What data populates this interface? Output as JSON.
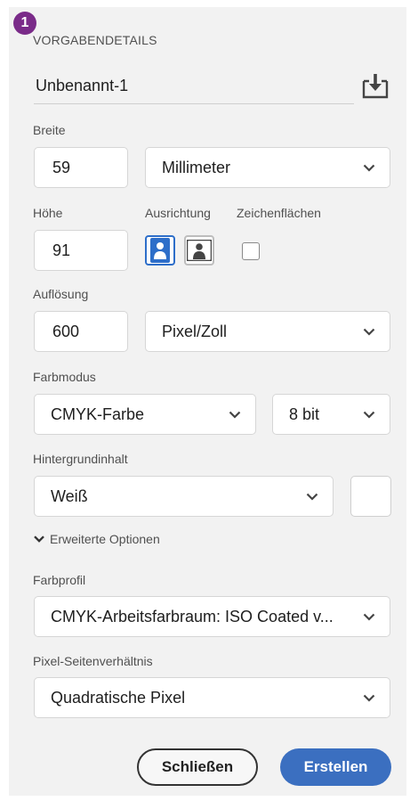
{
  "badge": "1",
  "preset": {
    "heading": "VORGABENDETAILS",
    "name": "Unbenannt-1"
  },
  "width": {
    "label": "Breite",
    "value": "59",
    "unit": "Millimeter"
  },
  "height": {
    "label": "Höhe",
    "value": "91"
  },
  "orientation": {
    "label": "Ausrichtung",
    "selected": "portrait"
  },
  "artboards": {
    "label": "Zeichenflächen",
    "checked": false
  },
  "resolution": {
    "label": "Auflösung",
    "value": "600",
    "unit": "Pixel/Zoll"
  },
  "color_mode": {
    "label": "Farbmodus",
    "mode": "CMYK-Farbe",
    "depth": "8 bit"
  },
  "background": {
    "label": "Hintergrundinhalt",
    "value": "Weiß",
    "swatch_color": "#ffffff"
  },
  "advanced": {
    "label": "Erweiterte Optionen"
  },
  "color_profile": {
    "label": "Farbprofil",
    "value": "CMYK-Arbeitsfarbraum: ISO Coated v..."
  },
  "pixel_aspect": {
    "label": "Pixel-Seitenverhältnis",
    "value": "Quadratische Pixel"
  },
  "buttons": {
    "close": "Schließen",
    "create": "Erstellen"
  },
  "colors": {
    "accent": "#3b6fc0",
    "badge": "#7a2b89",
    "selected_border": "#2d6ec9"
  },
  "icons": {
    "save_preset": "save-preset-icon",
    "portrait": "portrait-orientation-icon",
    "landscape": "landscape-orientation-icon",
    "chevron": "chevron-down-icon"
  }
}
